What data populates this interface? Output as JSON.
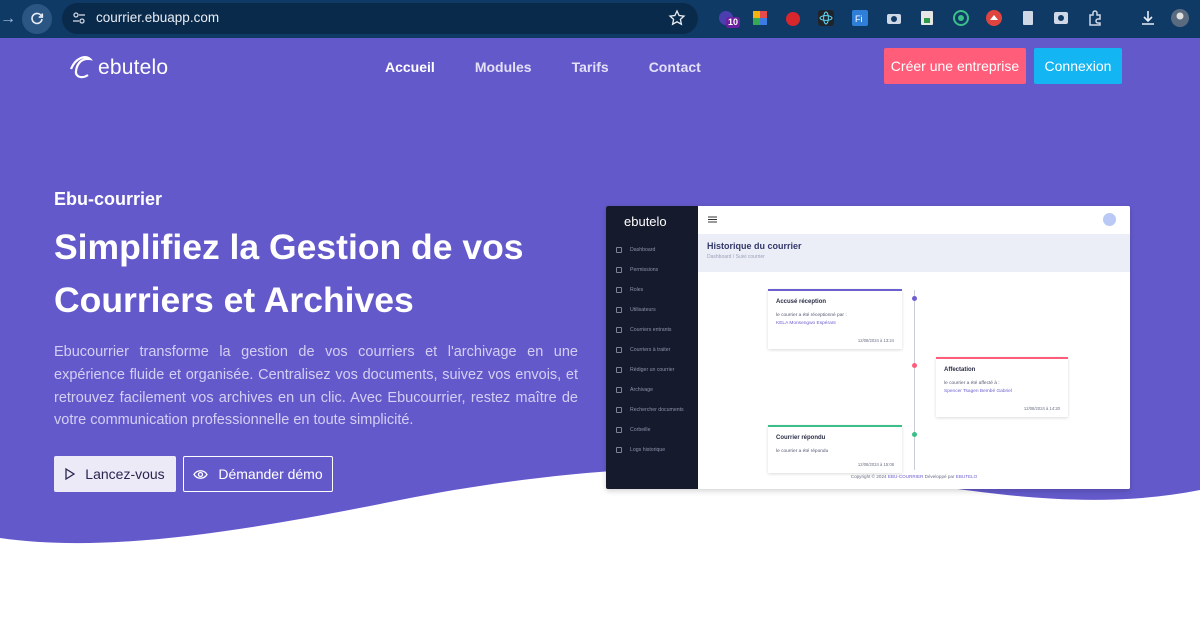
{
  "browser": {
    "url": "courrier.ebuapp.com",
    "extension_badge": "10"
  },
  "nav": {
    "logo_text": "ebutelo",
    "links": [
      "Accueil",
      "Modules",
      "Tarifs",
      "Contact"
    ],
    "active_link": "Accueil",
    "create_button": "Créer une entreprise",
    "login_button": "Connexion"
  },
  "hero": {
    "eyebrow": "Ebu-courrier",
    "headline": "Simplifiez la Gestion de vos Courriers et Archives",
    "lead": "Ebucourrier transforme la gestion de vos courriers et l'archivage en une expérience fluide et organisée. Centralisez vos documents, suivez vos envois, et retrouvez facilement vos archives en un clic. Avec Ebucourrier, restez maître de votre communication professionnelle en toute simplicité.",
    "start_button": "Lancez-vous",
    "demo_button": "Démander démo"
  },
  "mockup": {
    "logo_text": "ebutelo",
    "menu": [
      "Dashboard",
      "Permissions",
      "Roles",
      "Utilisateurs",
      "Courriers entrants",
      "Courriers à traiter",
      "Rédiger un courrier",
      "Archivage",
      "Rechercher documents",
      "Corbeille",
      "Logs historique"
    ],
    "page_title": "Historique du courrier",
    "breadcrumb": "Dashboard  /  Suivi courrier",
    "cards": [
      {
        "title": "Accusé réception",
        "text": "le courrier a été réceptionné par :",
        "link": "KELA Monsengwo Espérant",
        "date": "12/08/2024 à 13:24"
      },
      {
        "title": "Affectation",
        "text": "le courrier a été affecté à :",
        "link": "Spencer Tsagen Bembé Gabriel",
        "date": "12/08/2024 à 14:20"
      },
      {
        "title": "Courrier répondu",
        "text": "le courrier a été répondu",
        "link": "",
        "date": "12/08/2024 à 15:08"
      }
    ],
    "footer_prefix": "Copyright © 2024",
    "footer_brand": "EBU-COURRIER",
    "footer_mid": "Développé par",
    "footer_dev": "EBUTELO"
  },
  "colors": {
    "hero_bg": "#6459cb",
    "browser_chrome": "#0f3a66",
    "create_button": "#ff5d7a",
    "login_button": "#13b5f2"
  }
}
